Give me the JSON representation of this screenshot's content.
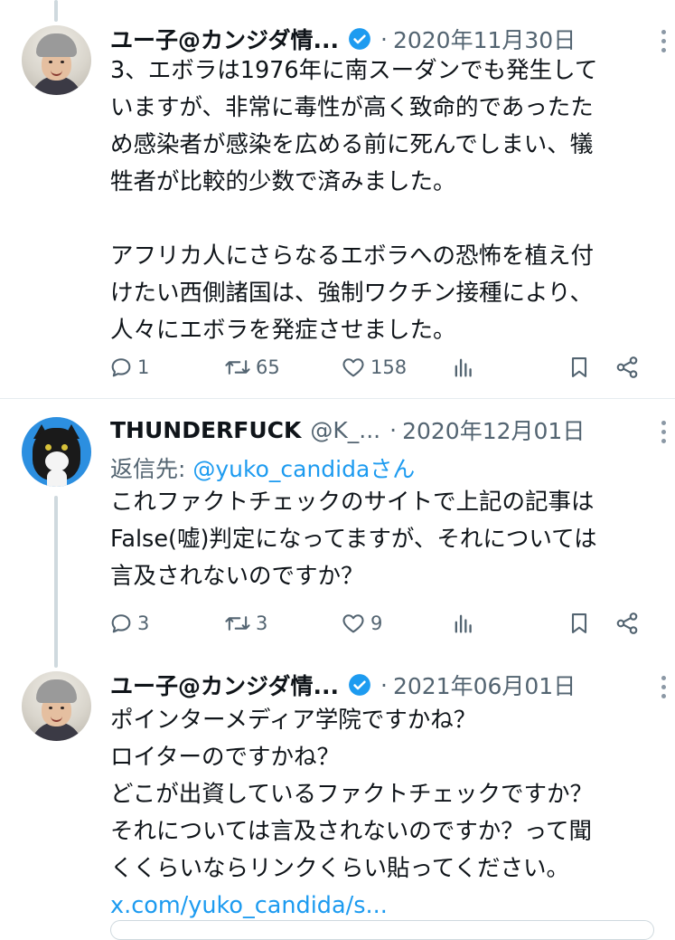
{
  "tweets": [
    {
      "author_name": "ユー子@カンジダ情...",
      "verified": true,
      "date": "2020年11月30日",
      "body_lines": [
        "3、エボラは1976年に南スーダンでも発生して",
        "いますが、非常に毒性が高く致命的であったた",
        "め感染者が感染を広める前に死んでしまい、犠",
        "牲者が比較的少数で済みました。",
        "",
        "アフリカ人にさらなるエボラへの恐怖を植え付",
        "けたい西側諸国は、強制ワクチン接種により、",
        "人々にエボラを発症させました。"
      ],
      "replies": "1",
      "retweets": "65",
      "likes": "158"
    },
    {
      "author_name": "THUNDERFUCK",
      "handle": "@K_...",
      "date": "2020年12月01日",
      "reply_prefix": "返信先: ",
      "reply_mention": "@yuko_candidaさん",
      "body_lines": [
        "これファクトチェックのサイトで上記の記事は",
        "False(嘘)判定になってますが、それについては",
        "言及されないのですか？"
      ],
      "replies": "3",
      "retweets": "3",
      "likes": "9"
    },
    {
      "author_name": "ユー子@カンジダ情...",
      "verified": true,
      "date": "2021年06月01日",
      "body_lines": [
        "ポインターメディア学院ですかね？",
        "ロイターのですかね？",
        "どこが出資しているファクトチェックですか？",
        "それについては言及されないのですか？って聞",
        "くくらいならリンクくらい貼ってください。"
      ],
      "link": "x.com/yuko_candida/s..."
    }
  ],
  "separator": "·",
  "icons": {
    "reply": "reply-icon",
    "retweet": "retweet-icon",
    "like": "heart-icon",
    "views": "views-chart-icon",
    "bookmark": "bookmark-icon",
    "share": "share-icon",
    "more": "more-dots-icon",
    "verified": "verified-badge-icon"
  },
  "colors": {
    "text": "#0f1419",
    "secondary": "#536471",
    "accent": "#1d9bf0",
    "thread_line": "#cfd9de"
  }
}
